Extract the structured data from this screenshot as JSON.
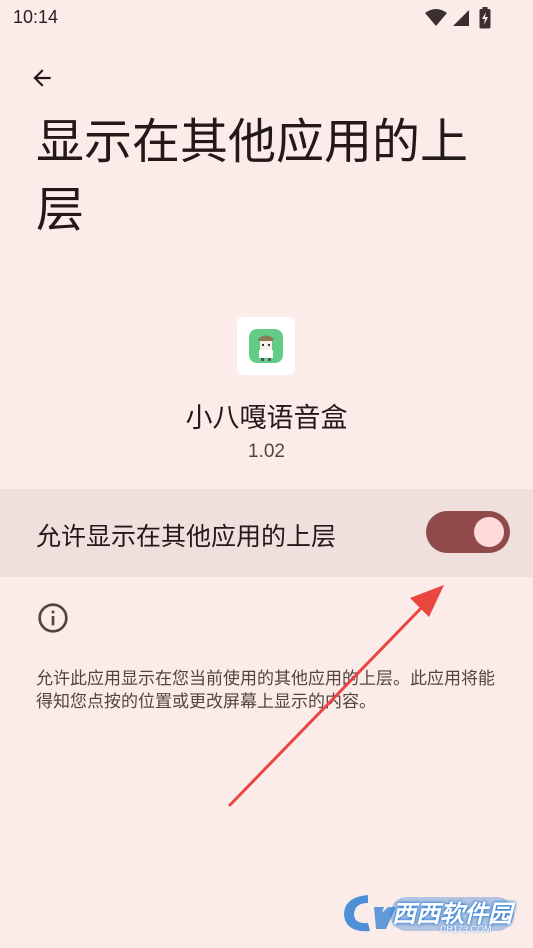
{
  "status_bar": {
    "time": "10:14"
  },
  "header": {
    "title": "显示在其他应用的上层"
  },
  "app": {
    "name": "小八嘎语音盒",
    "version": "1.02"
  },
  "permission_toggle": {
    "label": "允许显示在其他应用的上层",
    "state": "on"
  },
  "info": {
    "description": "允许此应用显示在您当前使用的其他应用的上层。此应用将能得知您点按的位置或更改屏幕上显示的内容。"
  },
  "watermark": {
    "brand": "西西软件园",
    "site": "CR173.COM"
  },
  "icons": {
    "back": "arrow-back-icon",
    "info": "info-icon",
    "wifi": "wifi-icon",
    "signal": "signal-icon",
    "battery": "battery-charging-icon"
  },
  "colors": {
    "background": "#fcece9",
    "toggle_row": "#efe0dd",
    "toggle_track": "#904a49",
    "toggle_thumb": "#ffdad8",
    "annotation_arrow": "#e8463f"
  }
}
